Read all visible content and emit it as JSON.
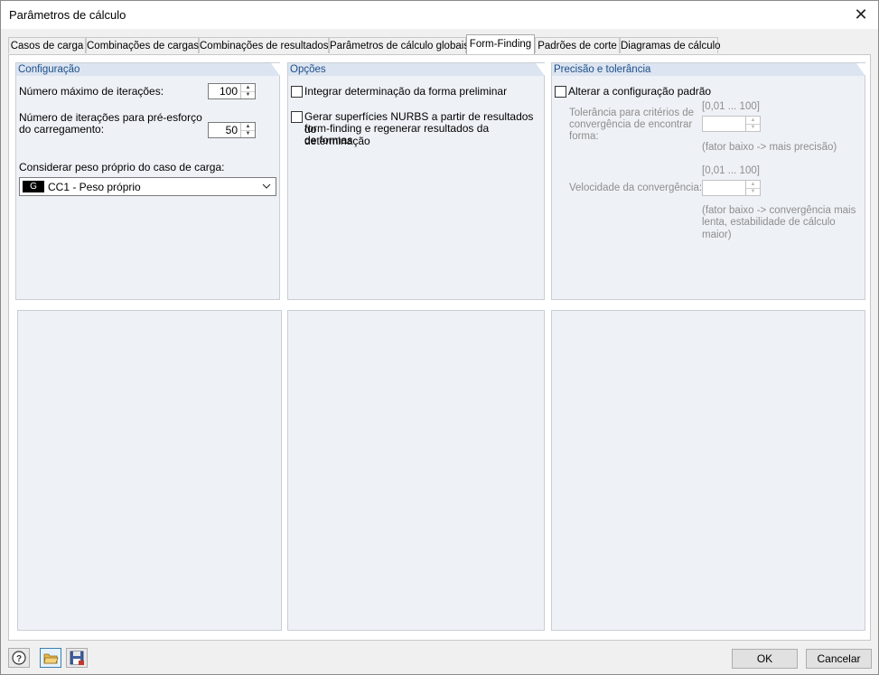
{
  "window": {
    "title": "Parâmetros de cálculo",
    "close_glyph": "✕"
  },
  "tabs": [
    {
      "label": "Casos de carga"
    },
    {
      "label": "Combinações de cargas"
    },
    {
      "label": "Combinações de resultados"
    },
    {
      "label": "Parâmetros de cálculo globais"
    },
    {
      "label": "Form-Finding",
      "active": true
    },
    {
      "label": "Padrões de corte"
    },
    {
      "label": "Diagramas de cálculo"
    }
  ],
  "configuracao": {
    "header": "Configuração",
    "max_iter_label": "Número máximo de iterações:",
    "max_iter_value": "100",
    "prestress_label_line1": "Número de iterações para pré-esforço",
    "prestress_label_line2": "do carregamento:",
    "prestress_value": "50",
    "selfweight_label": "Considerar peso próprio do caso de carga:",
    "selfweight_tag": "G",
    "selfweight_value": "CC1 - Peso próprio"
  },
  "opcoes": {
    "header": "Opções",
    "opt1_label": "Integrar determinação da forma preliminar",
    "opt1_checked": false,
    "opt2_line1": "Gerar superfícies NURBS a partir de resultados do",
    "opt2_line2": "form-finding e regenerar resultados da determinação",
    "opt2_line3": "de formas",
    "opt2_checked": false
  },
  "precisao": {
    "header": "Precisão e tolerância",
    "change_default_label": "Alterar a configuração padrão",
    "change_default_checked": false,
    "tolerance_range": "[0,01 ... 100]",
    "tolerance_label_line1": "Tolerância para critérios de",
    "tolerance_label_line2": "convergência de encontrar",
    "tolerance_label_line3": "forma:",
    "tolerance_value": "",
    "tolerance_hint": "(fator baixo -> mais precisão)",
    "speed_range": "[0,01 ... 100]",
    "speed_label": "Velocidade da convergência:",
    "speed_value": "",
    "speed_hint_line1": "(fator baixo -> convergência mais",
    "speed_hint_line2": "lenta, estabilidade de cálculo maior)"
  },
  "footer": {
    "icons": [
      "help-icon",
      "open-folder-icon",
      "save-icon"
    ],
    "ok_label": "OK",
    "cancel_label": "Cancelar"
  }
}
